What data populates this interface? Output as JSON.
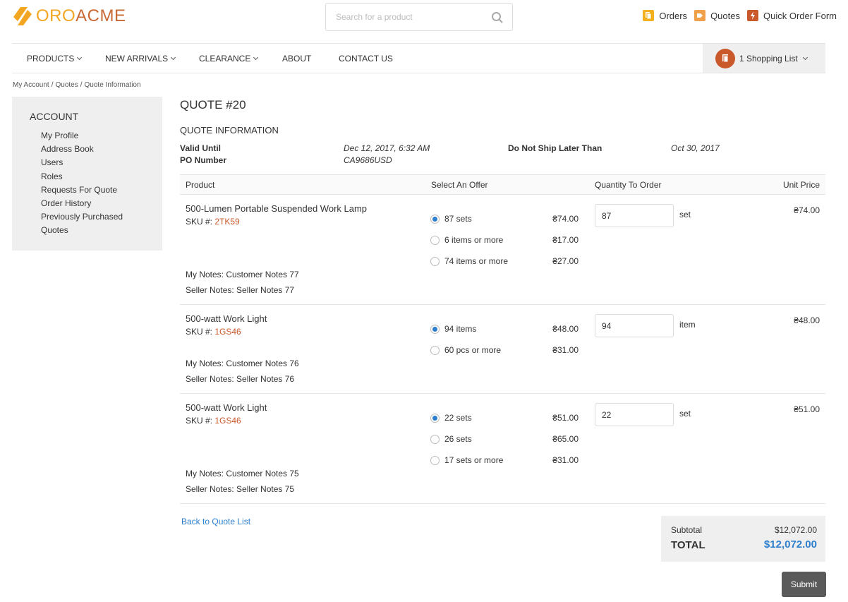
{
  "brand": {
    "part1": "ORO",
    "part2": "ACME"
  },
  "search": {
    "placeholder": "Search for a product"
  },
  "toplinks": [
    {
      "label": "Orders",
      "icon": "orders-icon",
      "color": "#f2b01e"
    },
    {
      "label": "Quotes",
      "icon": "quotes-icon",
      "color": "#f0a04b"
    },
    {
      "label": "Quick Order Form",
      "icon": "lightning-icon",
      "color": "#c9582b"
    }
  ],
  "nav": {
    "items": [
      {
        "label": "PRODUCTS",
        "dropdown": true
      },
      {
        "label": "NEW ARRIVALS",
        "dropdown": true
      },
      {
        "label": "CLEARANCE",
        "dropdown": true
      },
      {
        "label": "ABOUT",
        "dropdown": false
      },
      {
        "label": "CONTACT US",
        "dropdown": false
      }
    ],
    "shopping_list": "1 Shopping List"
  },
  "breadcrumb": {
    "a": "My Account",
    "b": "Quotes",
    "c": "Quote Information",
    "sep": "/"
  },
  "sidebar": {
    "title": "ACCOUNT",
    "items": [
      "My Profile",
      "Address Book",
      "Users",
      "Roles",
      "Requests For Quote",
      "Order History",
      "Previously Purchased",
      "Quotes"
    ]
  },
  "quote": {
    "title": "QUOTE #20",
    "section": "QUOTE INFORMATION",
    "valid_until_label": "Valid Until",
    "valid_until": "Dec 12, 2017, 6:32 AM",
    "po_label": "PO Number",
    "po": "CA9686USD",
    "ship_label": "Do Not Ship Later Than",
    "ship": "Oct 30, 2017"
  },
  "table": {
    "headers": {
      "product": "Product",
      "offer": "Select An Offer",
      "qty": "Quantity To Order",
      "price": "Unit Price"
    },
    "sku_label": "SKU #:",
    "rows": [
      {
        "name": "500-Lumen Portable Suspended Work Lamp",
        "sku": "2TK59",
        "offers": [
          {
            "label": "87 sets",
            "price": "₴74.00",
            "selected": true
          },
          {
            "label": "6 items or more",
            "price": "₴17.00",
            "selected": false
          },
          {
            "label": "74 items or more",
            "price": "₴27.00",
            "selected": false
          }
        ],
        "qty": "87",
        "unit": "set",
        "unit_price": "₴74.00",
        "my_notes": "My Notes: Customer Notes 77",
        "seller_notes": "Seller Notes: Seller Notes 77"
      },
      {
        "name": "500-watt Work Light",
        "sku": "1GS46",
        "offers": [
          {
            "label": "94 items",
            "price": "₴48.00",
            "selected": true
          },
          {
            "label": "60 pcs or more",
            "price": "₴31.00",
            "selected": false
          }
        ],
        "qty": "94",
        "unit": "item",
        "unit_price": "₴48.00",
        "my_notes": "My Notes: Customer Notes 76",
        "seller_notes": "Seller Notes: Seller Notes 76"
      },
      {
        "name": "500-watt Work Light",
        "sku": "1GS46",
        "offers": [
          {
            "label": "22 sets",
            "price": "₴51.00",
            "selected": true
          },
          {
            "label": "26 sets",
            "price": "₴65.00",
            "selected": false
          },
          {
            "label": "17 sets or more",
            "price": "₴31.00",
            "selected": false
          }
        ],
        "qty": "22",
        "unit": "set",
        "unit_price": "₴51.00",
        "my_notes": "My Notes: Customer Notes 75",
        "seller_notes": "Seller Notes: Seller Notes 75"
      }
    ]
  },
  "back_link": "Back to Quote List",
  "totals": {
    "subtotal_label": "Subtotal",
    "subtotal": "$12,072.00",
    "total_label": "TOTAL",
    "total": "$12,072.00"
  },
  "submit_label": "Submit",
  "colors": {
    "accent": "#2d7fcd",
    "sku": "#c9582b",
    "brand_orange": "#f2a622"
  }
}
